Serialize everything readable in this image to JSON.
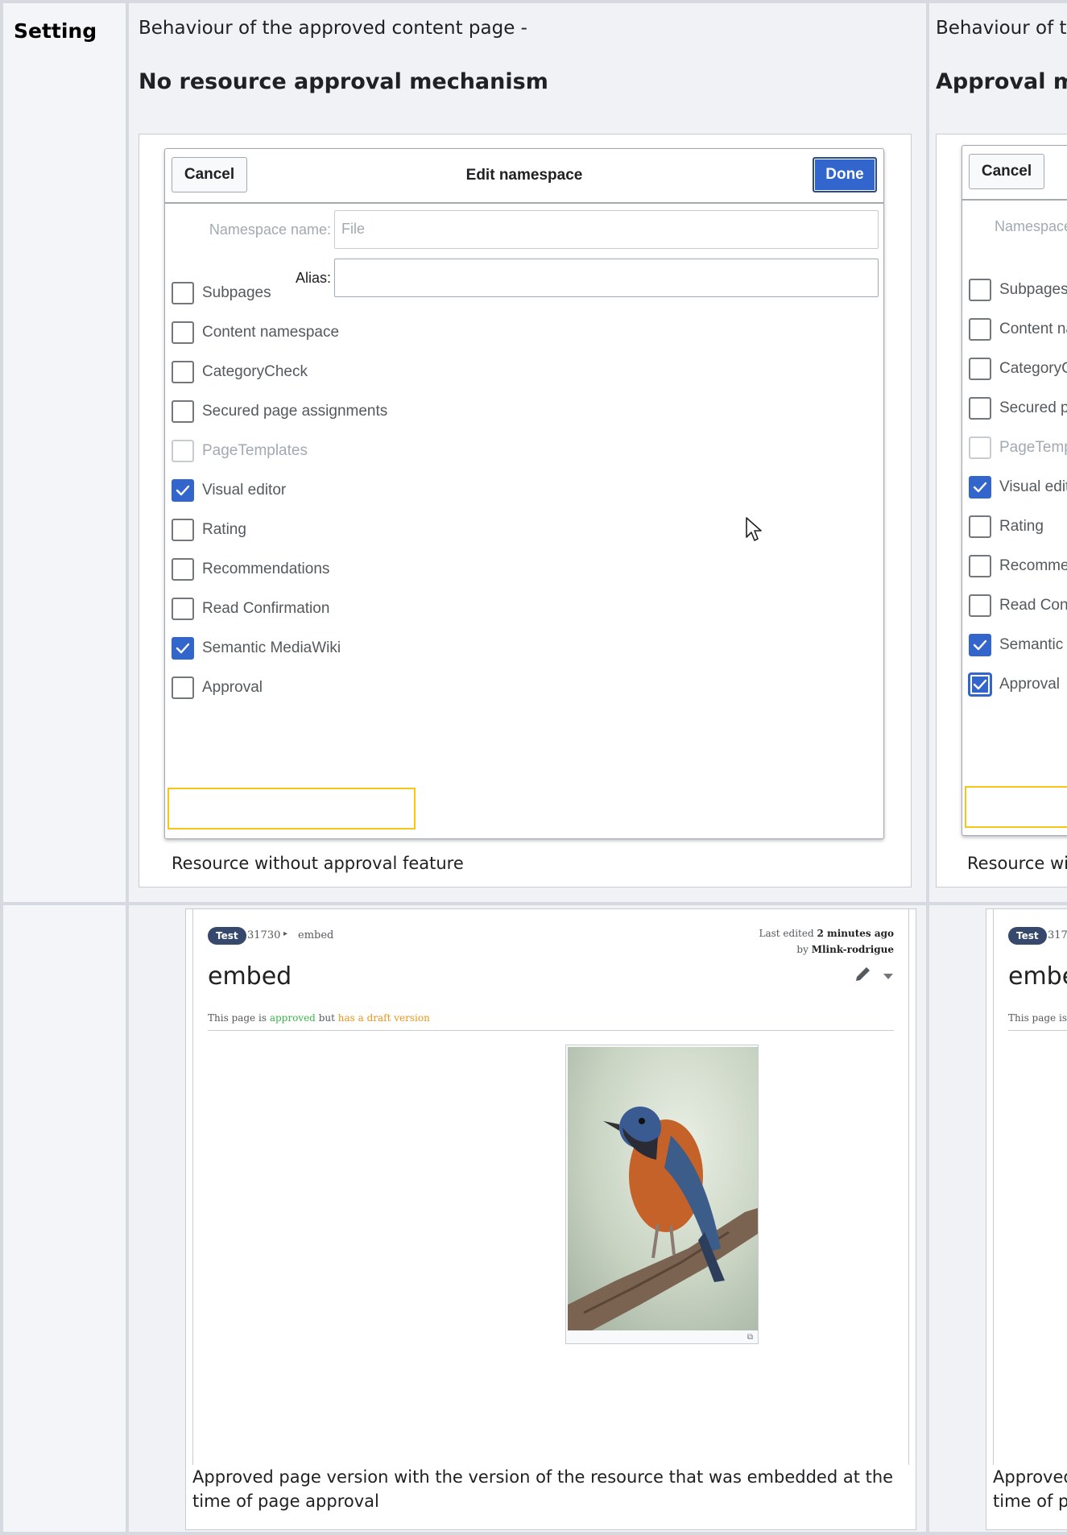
{
  "table": {
    "header_label": "Setting",
    "columns": [
      {
        "intro": "Behaviour of the approved content page -",
        "title": "No resource approval mechanism",
        "dialog_caption": "Resource without approval feature",
        "page_caption": "Approved page version with the version of the resource that was embedded at the time of page approval"
      },
      {
        "intro": "Behaviour of the approved content page -",
        "title": "Approval mechanism",
        "dialog_caption": "Resource with approval feature",
        "page_caption": "Approved page version with the version of the resource that was approved at the time of page approval"
      }
    ]
  },
  "dialog": {
    "cancel": "Cancel",
    "title": "Edit namespace",
    "done": "Done",
    "namespace_label": "Namespace name:",
    "namespace_value": "File",
    "alias_label": "Alias:",
    "alias_value": "",
    "options": [
      {
        "label": "Subpages",
        "checked": false,
        "disabled": false
      },
      {
        "label": "Content namespace",
        "checked": false,
        "disabled": false
      },
      {
        "label": "CategoryCheck",
        "checked": false,
        "disabled": false
      },
      {
        "label": "Secured page assignments",
        "checked": false,
        "disabled": false
      },
      {
        "label": "PageTemplates",
        "checked": false,
        "disabled": true
      },
      {
        "label": "Visual editor",
        "checked": true,
        "disabled": false
      },
      {
        "label": "Rating",
        "checked": false,
        "disabled": false
      },
      {
        "label": "Recommendations",
        "checked": false,
        "disabled": false
      },
      {
        "label": "Read Confirmation",
        "checked": false,
        "disabled": false
      },
      {
        "label": "Semantic MediaWiki",
        "checked": true,
        "disabled": false
      },
      {
        "label": "Approval",
        "checked": false,
        "disabled": false
      }
    ],
    "approval_checked_right": true
  },
  "page": {
    "badge": "Test",
    "crumb_id": "31730",
    "crumb_sep": "▸",
    "crumb_page": "embed",
    "last_edited_prefix": "Last edited",
    "last_edited_time": "2 minutes ago",
    "by_prefix": "by",
    "author": "Mlink-rodrigue",
    "title": "embed",
    "status_prefix": "This page is",
    "status_approved": "approved",
    "status_mid": "but",
    "status_draft": "has a draft version"
  },
  "colors": {
    "accent": "#3366cc",
    "highlight": "#f5c518",
    "approved": "#3db54a",
    "draft": "#e8951c",
    "badge": "#36486b"
  }
}
